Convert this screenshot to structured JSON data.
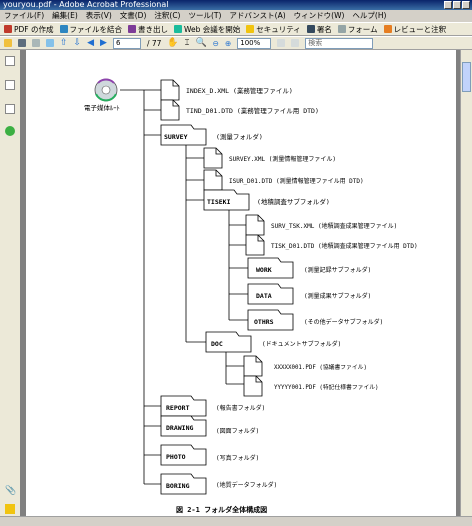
{
  "window": {
    "title": "youryou.pdf - Adobe Acrobat Professional"
  },
  "menu": [
    "ファイル(F)",
    "編集(E)",
    "表示(V)",
    "文書(D)",
    "注釈(C)",
    "ツール(T)",
    "アドバンスト(A)",
    "ウィンドウ(W)",
    "ヘルプ(H)"
  ],
  "toolbar": {
    "create_pdf": "PDF の作成",
    "combine": "ファイルを結合",
    "export": "書き出し",
    "web_meeting": "Web 会議を開始",
    "security": "セキュリティ",
    "sign": "署名",
    "forms": "フォーム",
    "review": "レビューと注釈",
    "page_current": "6",
    "page_total": "/ 77",
    "zoom": "100%",
    "search_placeholder": "検索"
  },
  "tree": {
    "root_label": "電子媒体ﾙｰﾄ",
    "index_file": "INDEX_D.XML (業務管理ファイル)",
    "index_dtd": "TIND_D01.DTD (業務管理ファイル用 DTD)",
    "survey": {
      "name": "SURVEY",
      "desc": "(測量フォルダ)"
    },
    "survey_xml": "SURVEY.XML (測量情報管理ファイル)",
    "survey_dtd": "ISUR_D01.DTD (測量情報管理ファイル用 DTD)",
    "tiseki": {
      "name": "TISEKI",
      "desc": "(地積調査サブフォルダ)"
    },
    "tiseki_xml": "SURV_TSK.XML (地積調査成果管理ファイル)",
    "tiseki_dtd": "TISK_D01.DTD (地積調査成果管理ファイル用 DTD)",
    "work": {
      "name": "WORK",
      "desc": "(測量記録サブフォルダ)"
    },
    "data": {
      "name": "DATA",
      "desc": "(測量成果サブフォルダ)"
    },
    "others": {
      "name": "OTHRS",
      "desc": "(その他データサブフォルダ)"
    },
    "doc": {
      "name": "DOC",
      "desc": "(ドキュメントサブフォルダ)"
    },
    "doc_file1": "XXXXX001.PDF (協議書ファイル)",
    "doc_file2": "YYYYY001.PDF (特記仕様書ファイル)",
    "report": {
      "name": "REPORT",
      "desc": "(報告書フォルダ)"
    },
    "drawing": {
      "name": "DRAWING",
      "desc": "(図面フォルダ)"
    },
    "photo": {
      "name": "PHOTO",
      "desc": "(写真フォルダ)"
    },
    "boring": {
      "name": "BORING",
      "desc": "(地質データフォルダ)"
    },
    "caption": "図 2-1 フォルダ全体構成図"
  },
  "colors": {
    "titlebar": "#0a246a",
    "chrome": "#d4d0c8",
    "doc_bg": "#808080"
  }
}
